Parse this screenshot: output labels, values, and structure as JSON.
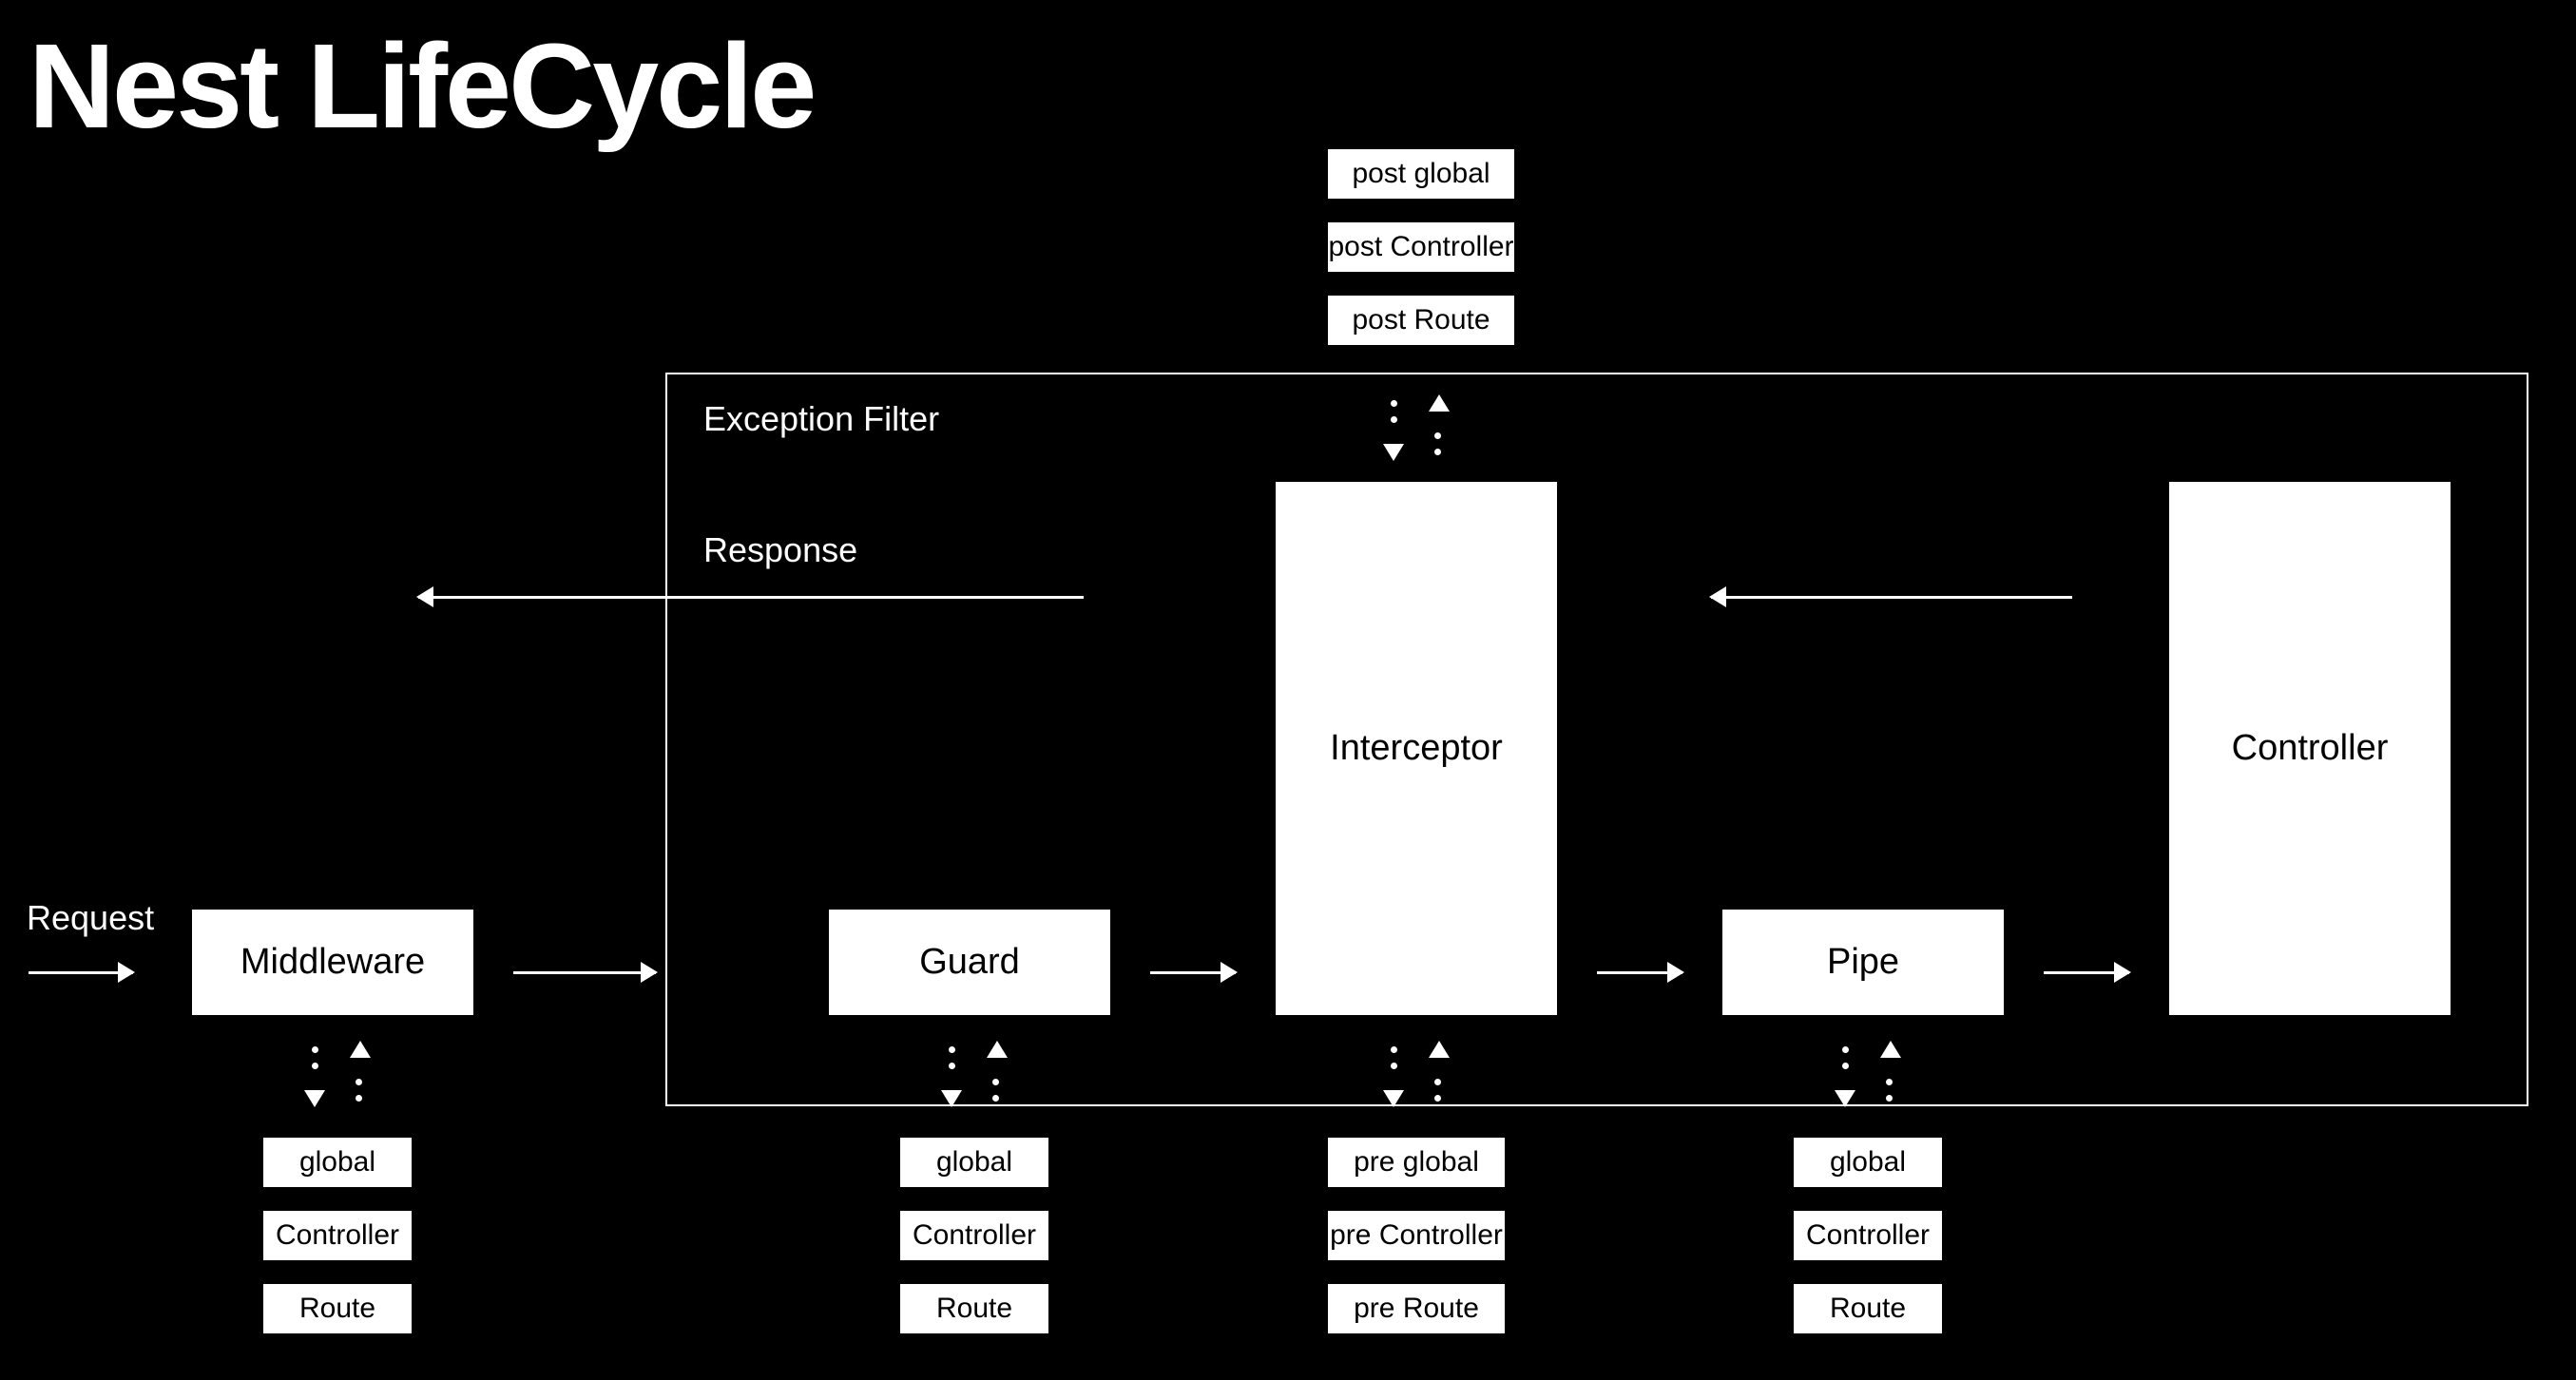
{
  "title": "Nest LifeCycle",
  "labels": {
    "request": "Request",
    "response": "Response",
    "exceptionFilter": "Exception Filter"
  },
  "boxes": {
    "middleware": "Middleware",
    "guard": "Guard",
    "interceptor": "Interceptor",
    "pipe": "Pipe",
    "controller": "Controller"
  },
  "middlewareStack": {
    "l0": "global",
    "l1": "Controller",
    "l2": "Route"
  },
  "guardStack": {
    "l0": "global",
    "l1": "Controller",
    "l2": "Route"
  },
  "pipeStack": {
    "l0": "global",
    "l1": "Controller",
    "l2": "Route"
  },
  "interceptorPre": {
    "l0": "pre global",
    "l1": "pre Controller",
    "l2": "pre Route"
  },
  "interceptorPost": {
    "l0": "post global",
    "l1": "post Controller",
    "l2": "post Route"
  }
}
